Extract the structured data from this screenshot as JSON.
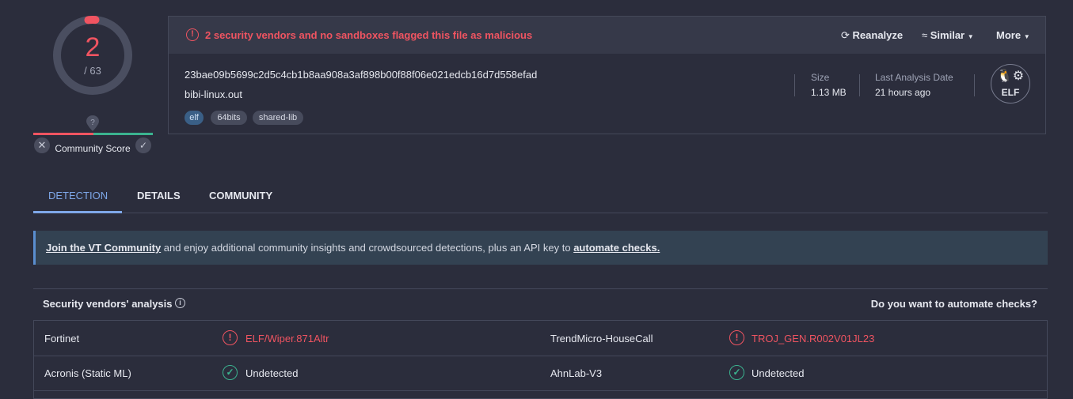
{
  "score": {
    "detections": "2",
    "total": "/ 63"
  },
  "community": {
    "label": "Community Score"
  },
  "alert": {
    "text": "2 security vendors and no sandboxes flagged this file as malicious"
  },
  "actions": {
    "reanalyze": "Reanalyze",
    "similar": "Similar",
    "more": "More"
  },
  "file": {
    "hash": "23bae09b5699c2d5c4cb1b8aa908a3af898b00f88f06e021edcb16d7d558efad",
    "name": "bibi-linux.out",
    "tags": [
      "elf",
      "64bits",
      "shared-lib"
    ],
    "size_label": "Size",
    "size_value": "1.13 MB",
    "date_label": "Last Analysis Date",
    "date_value": "21 hours ago",
    "type_label": "ELF"
  },
  "tabs": [
    "DETECTION",
    "DETAILS",
    "COMMUNITY"
  ],
  "banner": {
    "link1": "Join the VT Community",
    "middle": " and enjoy additional community insights and crowdsourced detections, plus an API key to ",
    "link2": "automate checks."
  },
  "vendors": {
    "title": "Security vendors' analysis",
    "automate": "Do you want to automate checks?",
    "rows": [
      {
        "left_vendor": "Fortinet",
        "left_result": "ELF/Wiper.871Altr",
        "right_vendor": "TrendMicro-HouseCall",
        "right_result": "TROJ_GEN.R002V01JL23"
      },
      {
        "left_vendor": "Acronis (Static ML)",
        "left_result": "Undetected",
        "right_vendor": "AhnLab-V3",
        "right_result": "Undetected"
      }
    ]
  },
  "colors": {
    "malicious": "#f05461",
    "clean": "#3bb38f",
    "accent": "#7ea7e8"
  },
  "icons": {
    "alert": "alert-circle-icon",
    "reanalyze": "refresh-icon",
    "similar": "similar-icon",
    "chevron": "chevron-down-icon",
    "linux": "linux-tux-icon",
    "info": "info-icon",
    "malicious": "alert-circle-icon",
    "clean": "check-circle-icon"
  }
}
